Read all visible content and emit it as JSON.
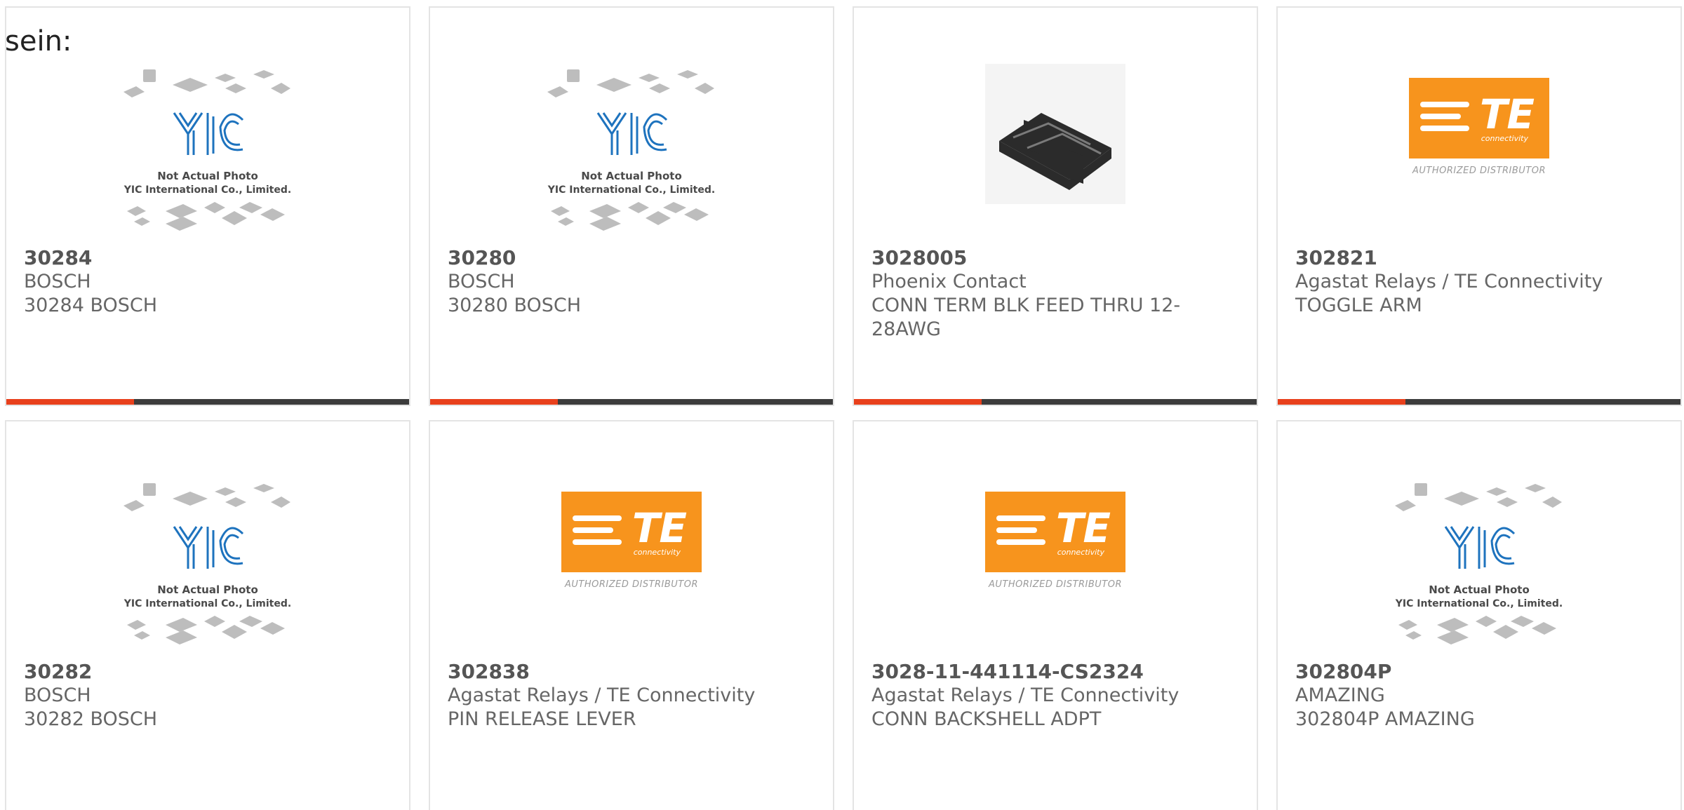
{
  "intro": "sein:",
  "placeholder": {
    "line1": "Not Actual Photo",
    "line2": "YIC International Co., Limited."
  },
  "te_logo": {
    "letters": "TE",
    "sub": "connectivity",
    "caption": "AUTHORIZED DISTRIBUTOR",
    "color": "#f7941d"
  },
  "colors": {
    "accent": "#e8401c",
    "bar": "#3c3c3c",
    "text": "#666666"
  },
  "products": [
    {
      "part": "30284",
      "maker": "BOSCH",
      "desc": "30284 BOSCH",
      "image": "yic-placeholder-image"
    },
    {
      "part": "30280",
      "maker": "BOSCH",
      "desc": "30280 BOSCH",
      "image": "yic-placeholder-image"
    },
    {
      "part": "3028005",
      "maker": "Phoenix Contact",
      "desc": "CONN TERM BLK FEED THRU 12-28AWG",
      "image": "terminal-block-photo"
    },
    {
      "part": "302821",
      "maker": "Agastat Relays / TE Connectivity",
      "desc": "TOGGLE ARM",
      "image": "te-logo-image"
    },
    {
      "part": "30282",
      "maker": "BOSCH",
      "desc": "30282 BOSCH",
      "image": "yic-placeholder-image"
    },
    {
      "part": "302838",
      "maker": "Agastat Relays / TE Connectivity",
      "desc": "PIN RELEASE LEVER",
      "image": "te-logo-image"
    },
    {
      "part": "3028-11-441114-CS2324",
      "maker": "Agastat Relays / TE Connectivity",
      "desc": "CONN BACKSHELL ADPT",
      "image": "te-logo-image"
    },
    {
      "part": "302804P",
      "maker": "AMAZING",
      "desc": "302804P AMAZING",
      "image": "yic-placeholder-image"
    }
  ]
}
